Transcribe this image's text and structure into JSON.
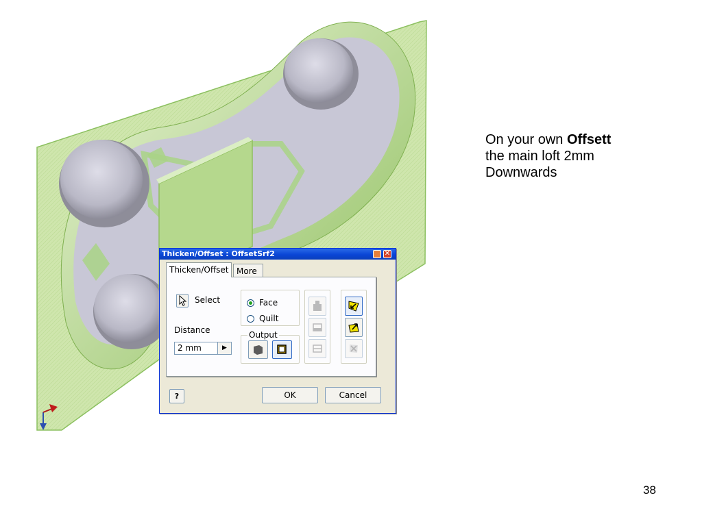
{
  "slide": {
    "instruction_line1_prefix": "On your own ",
    "instruction_line1_bold": "Offsett",
    "instruction_line2": "the main loft 2mm",
    "instruction_line3": "Downwards",
    "page_number": "38"
  },
  "dialog": {
    "title": "Thicken/Offset : OffsetSrf2",
    "close_glyph": "✕",
    "tabs": [
      {
        "label": "Thicken/Offset",
        "active": true
      },
      {
        "label": "More",
        "active": false
      }
    ],
    "select_label": "Select",
    "distance_label": "Distance",
    "distance_value": "2 mm",
    "distance_arrow": "▶",
    "mode_options": [
      {
        "label": "Face",
        "checked": true
      },
      {
        "label": "Quilt",
        "checked": false
      }
    ],
    "output_label": "Output",
    "help_label": "?",
    "ok_label": "OK",
    "cancel_label": "Cancel"
  },
  "colors": {
    "surface_green": "#c9e2a4",
    "part_gray": "#c6c5d3",
    "dialog_bg": "#ece9d8",
    "title_blue": "#0a46d6"
  }
}
